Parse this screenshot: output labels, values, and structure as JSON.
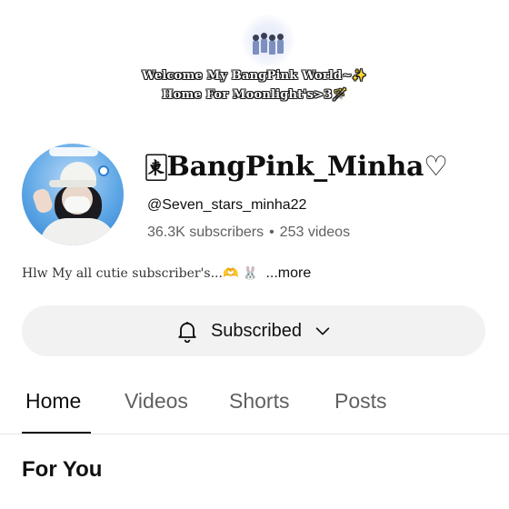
{
  "banner": {
    "line1": "Welcome My BangPink World~✨",
    "line2": "Home For Moonlight's>3🪄"
  },
  "channel": {
    "name": "🀀BangPink_Minha♡",
    "handle": "@Seven_stars_minha22",
    "subscribers": "36.3K subscribers",
    "separator": "•",
    "videos": "253 videos",
    "description": "Hlw My all cutie subscriber's...🫶 🐰",
    "more_label": "...more"
  },
  "subscribe_button": {
    "label": "Subscribed",
    "icon": "bell-icon",
    "dropdown_icon": "chevron-down-icon"
  },
  "tabs": [
    {
      "label": "Home",
      "active": true
    },
    {
      "label": "Videos",
      "active": false
    },
    {
      "label": "Shorts",
      "active": false
    },
    {
      "label": "Posts",
      "active": false
    }
  ],
  "section": {
    "title": "For You"
  },
  "colors": {
    "text_primary": "#0f0f0f",
    "text_secondary": "#606060",
    "button_bg": "#f2f2f2",
    "divider": "#e5e5e5"
  }
}
